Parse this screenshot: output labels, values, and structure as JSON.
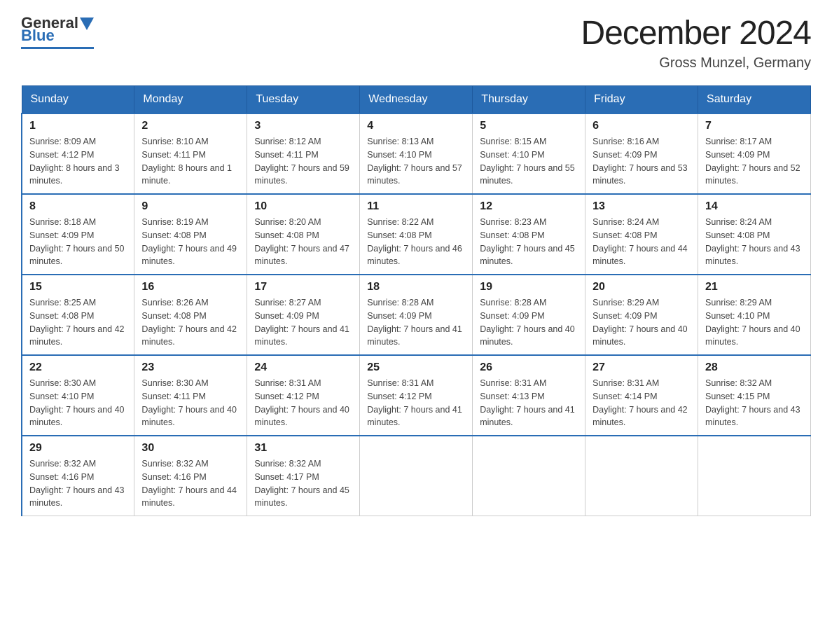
{
  "header": {
    "logo_general": "General",
    "logo_blue": "Blue",
    "main_title": "December 2024",
    "subtitle": "Gross Munzel, Germany"
  },
  "days_of_week": [
    "Sunday",
    "Monday",
    "Tuesday",
    "Wednesday",
    "Thursday",
    "Friday",
    "Saturday"
  ],
  "weeks": [
    [
      {
        "day": "1",
        "sunrise": "8:09 AM",
        "sunset": "4:12 PM",
        "daylight": "8 hours and 3 minutes."
      },
      {
        "day": "2",
        "sunrise": "8:10 AM",
        "sunset": "4:11 PM",
        "daylight": "8 hours and 1 minute."
      },
      {
        "day": "3",
        "sunrise": "8:12 AM",
        "sunset": "4:11 PM",
        "daylight": "7 hours and 59 minutes."
      },
      {
        "day": "4",
        "sunrise": "8:13 AM",
        "sunset": "4:10 PM",
        "daylight": "7 hours and 57 minutes."
      },
      {
        "day": "5",
        "sunrise": "8:15 AM",
        "sunset": "4:10 PM",
        "daylight": "7 hours and 55 minutes."
      },
      {
        "day": "6",
        "sunrise": "8:16 AM",
        "sunset": "4:09 PM",
        "daylight": "7 hours and 53 minutes."
      },
      {
        "day": "7",
        "sunrise": "8:17 AM",
        "sunset": "4:09 PM",
        "daylight": "7 hours and 52 minutes."
      }
    ],
    [
      {
        "day": "8",
        "sunrise": "8:18 AM",
        "sunset": "4:09 PM",
        "daylight": "7 hours and 50 minutes."
      },
      {
        "day": "9",
        "sunrise": "8:19 AM",
        "sunset": "4:08 PM",
        "daylight": "7 hours and 49 minutes."
      },
      {
        "day": "10",
        "sunrise": "8:20 AM",
        "sunset": "4:08 PM",
        "daylight": "7 hours and 47 minutes."
      },
      {
        "day": "11",
        "sunrise": "8:22 AM",
        "sunset": "4:08 PM",
        "daylight": "7 hours and 46 minutes."
      },
      {
        "day": "12",
        "sunrise": "8:23 AM",
        "sunset": "4:08 PM",
        "daylight": "7 hours and 45 minutes."
      },
      {
        "day": "13",
        "sunrise": "8:24 AM",
        "sunset": "4:08 PM",
        "daylight": "7 hours and 44 minutes."
      },
      {
        "day": "14",
        "sunrise": "8:24 AM",
        "sunset": "4:08 PM",
        "daylight": "7 hours and 43 minutes."
      }
    ],
    [
      {
        "day": "15",
        "sunrise": "8:25 AM",
        "sunset": "4:08 PM",
        "daylight": "7 hours and 42 minutes."
      },
      {
        "day": "16",
        "sunrise": "8:26 AM",
        "sunset": "4:08 PM",
        "daylight": "7 hours and 42 minutes."
      },
      {
        "day": "17",
        "sunrise": "8:27 AM",
        "sunset": "4:09 PM",
        "daylight": "7 hours and 41 minutes."
      },
      {
        "day": "18",
        "sunrise": "8:28 AM",
        "sunset": "4:09 PM",
        "daylight": "7 hours and 41 minutes."
      },
      {
        "day": "19",
        "sunrise": "8:28 AM",
        "sunset": "4:09 PM",
        "daylight": "7 hours and 40 minutes."
      },
      {
        "day": "20",
        "sunrise": "8:29 AM",
        "sunset": "4:09 PM",
        "daylight": "7 hours and 40 minutes."
      },
      {
        "day": "21",
        "sunrise": "8:29 AM",
        "sunset": "4:10 PM",
        "daylight": "7 hours and 40 minutes."
      }
    ],
    [
      {
        "day": "22",
        "sunrise": "8:30 AM",
        "sunset": "4:10 PM",
        "daylight": "7 hours and 40 minutes."
      },
      {
        "day": "23",
        "sunrise": "8:30 AM",
        "sunset": "4:11 PM",
        "daylight": "7 hours and 40 minutes."
      },
      {
        "day": "24",
        "sunrise": "8:31 AM",
        "sunset": "4:12 PM",
        "daylight": "7 hours and 40 minutes."
      },
      {
        "day": "25",
        "sunrise": "8:31 AM",
        "sunset": "4:12 PM",
        "daylight": "7 hours and 41 minutes."
      },
      {
        "day": "26",
        "sunrise": "8:31 AM",
        "sunset": "4:13 PM",
        "daylight": "7 hours and 41 minutes."
      },
      {
        "day": "27",
        "sunrise": "8:31 AM",
        "sunset": "4:14 PM",
        "daylight": "7 hours and 42 minutes."
      },
      {
        "day": "28",
        "sunrise": "8:32 AM",
        "sunset": "4:15 PM",
        "daylight": "7 hours and 43 minutes."
      }
    ],
    [
      {
        "day": "29",
        "sunrise": "8:32 AM",
        "sunset": "4:16 PM",
        "daylight": "7 hours and 43 minutes."
      },
      {
        "day": "30",
        "sunrise": "8:32 AM",
        "sunset": "4:16 PM",
        "daylight": "7 hours and 44 minutes."
      },
      {
        "day": "31",
        "sunrise": "8:32 AM",
        "sunset": "4:17 PM",
        "daylight": "7 hours and 45 minutes."
      },
      null,
      null,
      null,
      null
    ]
  ],
  "labels": {
    "sunrise": "Sunrise:",
    "sunset": "Sunset:",
    "daylight": "Daylight:"
  }
}
